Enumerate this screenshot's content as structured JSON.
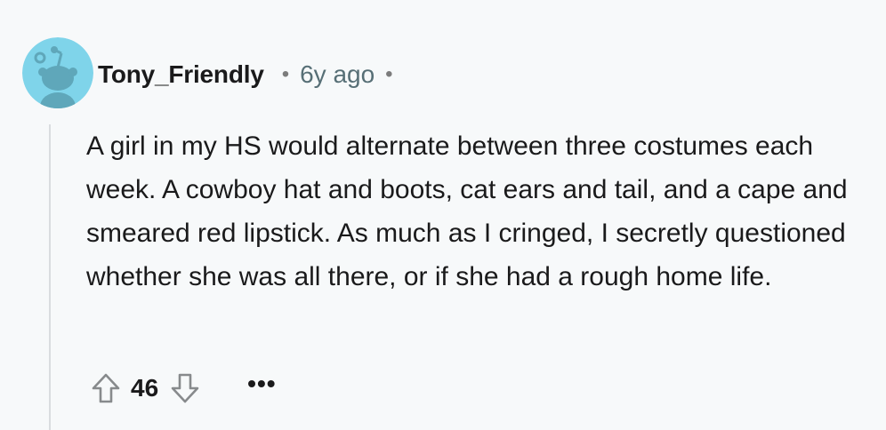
{
  "comment": {
    "username": "Tony_Friendly",
    "separator": "•",
    "timestamp": "6y ago",
    "trailing_separator": "•",
    "text": "A girl in my HS would alternate between three costumes each week. A cowboy hat and boots, cat ears and tail, and a cape and smeared red lipstick. As much as I cringed, I secretly questioned whether she was all there, or if she had a rough home life.",
    "score": "46",
    "more_label": "•••",
    "avatar_color": "#7fd4ea",
    "avatar_figure_color": "#5fa7ba"
  }
}
